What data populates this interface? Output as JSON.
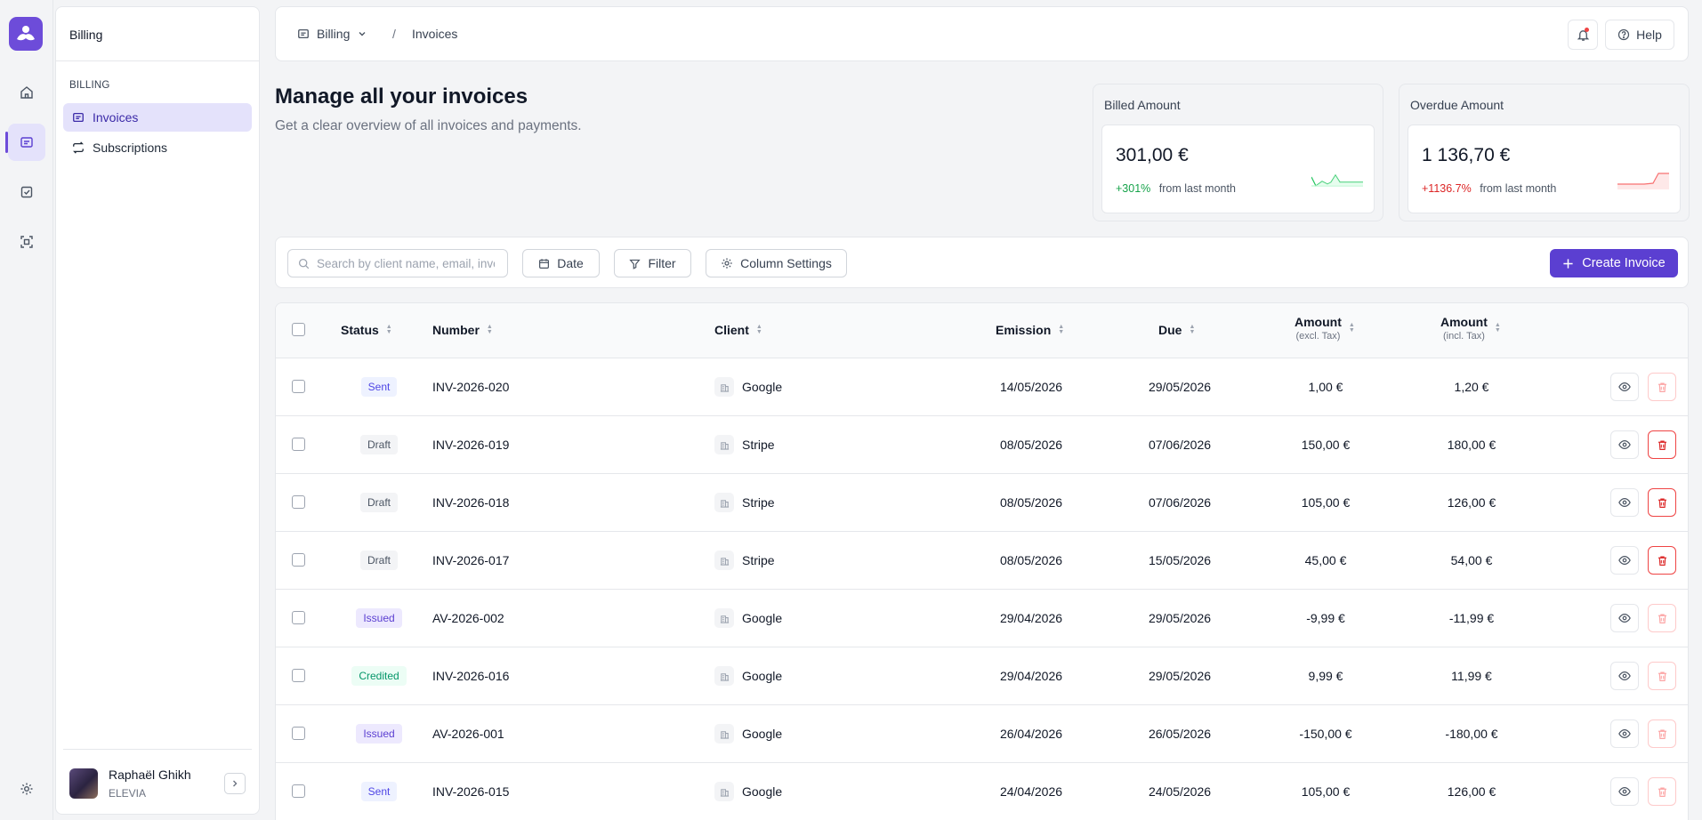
{
  "sidebar": {
    "title": "Billing",
    "section": "BILLING",
    "items": [
      {
        "label": "Invoices"
      },
      {
        "label": "Subscriptions"
      }
    ],
    "user": {
      "name": "Raphaël Ghikh",
      "org": "ELEVIA"
    }
  },
  "header": {
    "crumb_root": "Billing",
    "crumb_sep": "/",
    "crumb_current": "Invoices",
    "help_label": "Help"
  },
  "hero": {
    "title": "Manage all your invoices",
    "subtitle": "Get a clear overview of all invoices and payments."
  },
  "stats": [
    {
      "label": "Billed Amount",
      "value": "301,00 €",
      "delta": "+301%",
      "delta_label": "from last month",
      "color": "#16a34a"
    },
    {
      "label": "Overdue Amount",
      "value": "1 136,70 €",
      "delta": "+1136.7%",
      "delta_label": "from last month",
      "color": "#dc2626"
    }
  ],
  "toolbar": {
    "search_placeholder": "Search by client name, email, invoice number...",
    "date_label": "Date",
    "filter_label": "Filter",
    "columns_label": "Column Settings",
    "create_label": "Create Invoice"
  },
  "table": {
    "headers": {
      "status": "Status",
      "number": "Number",
      "client": "Client",
      "emission": "Emission",
      "due": "Due",
      "amount_excl": "Amount",
      "amount_excl_sub": "(excl. Tax)",
      "amount_incl": "Amount",
      "amount_incl_sub": "(incl. Tax)"
    },
    "rows": [
      {
        "status": "Sent",
        "number": "INV-2026-020",
        "client": "Google",
        "emission": "14/05/2026",
        "due": "29/05/2026",
        "excl": "1,00 €",
        "incl": "1,20 €"
      },
      {
        "status": "Draft",
        "number": "INV-2026-019",
        "client": "Stripe",
        "emission": "08/05/2026",
        "due": "07/06/2026",
        "excl": "150,00 €",
        "incl": "180,00 €"
      },
      {
        "status": "Draft",
        "number": "INV-2026-018",
        "client": "Stripe",
        "emission": "08/05/2026",
        "due": "07/06/2026",
        "excl": "105,00 €",
        "incl": "126,00 €"
      },
      {
        "status": "Draft",
        "number": "INV-2026-017",
        "client": "Stripe",
        "emission": "08/05/2026",
        "due": "15/05/2026",
        "excl": "45,00 €",
        "incl": "54,00 €"
      },
      {
        "status": "Issued",
        "number": "AV-2026-002",
        "client": "Google",
        "emission": "29/04/2026",
        "due": "29/05/2026",
        "excl": "-9,99 €",
        "incl": "-11,99 €"
      },
      {
        "status": "Credited",
        "number": "INV-2026-016",
        "client": "Google",
        "emission": "29/04/2026",
        "due": "29/05/2026",
        "excl": "9,99 €",
        "incl": "11,99 €"
      },
      {
        "status": "Issued",
        "number": "AV-2026-001",
        "client": "Google",
        "emission": "26/04/2026",
        "due": "26/05/2026",
        "excl": "-150,00 €",
        "incl": "-180,00 €"
      },
      {
        "status": "Sent",
        "number": "INV-2026-015",
        "client": "Google",
        "emission": "24/04/2026",
        "due": "24/05/2026",
        "excl": "105,00 €",
        "incl": "126,00 €"
      }
    ]
  },
  "colors": {
    "accent": "#5b3fd1",
    "accent_soft": "#e4e2fb",
    "positive": "#16a34a",
    "negative": "#dc2626"
  }
}
